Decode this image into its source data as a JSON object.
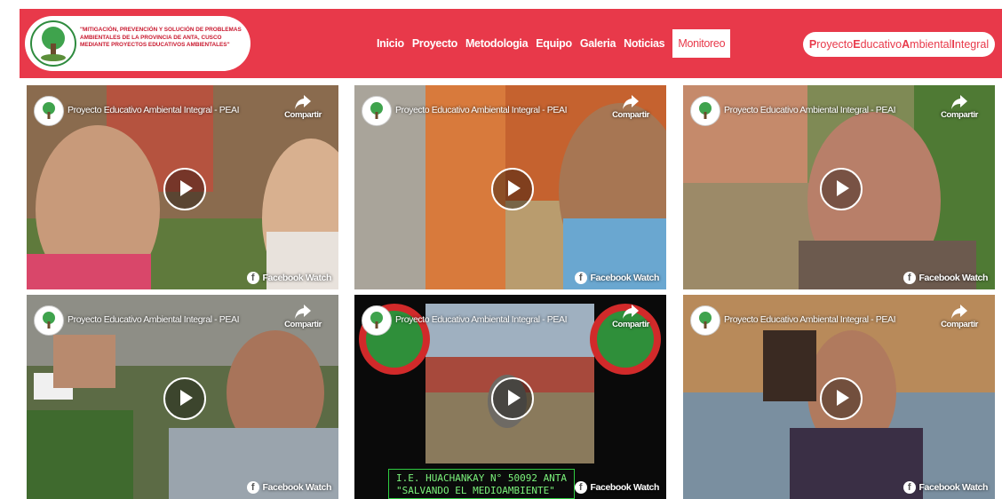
{
  "header": {
    "logo_text": "\"Mitigación, prevención y solución de problemas ambientales de la provincia de Anta, Cusco mediante proyectos educativos ambientales\"",
    "nav": [
      "Inicio",
      "Proyecto",
      "Metodologia",
      "Equipo",
      "Galeria",
      "Noticias",
      "Monitoreo"
    ],
    "active_nav": "Monitoreo",
    "brand": [
      "P",
      "royecto ",
      "E",
      "ducativo ",
      "A",
      "mbiental ",
      "I",
      "ntegral"
    ]
  },
  "videos": [
    {
      "channel": "Proyecto Educativo Ambiental Integral - PEAI",
      "share": "Compartir",
      "watch": "Facebook Watch"
    },
    {
      "channel": "Proyecto Educativo Ambiental Integral - PEAI",
      "share": "Compartir",
      "watch": "Facebook Watch"
    },
    {
      "channel": "Proyecto Educativo Ambiental Integral - PEAI",
      "share": "Compartir",
      "watch": "Facebook Watch"
    },
    {
      "channel": "Proyecto Educativo Ambiental Integral - PEAI",
      "share": "Compartir",
      "watch": "Facebook Watch"
    },
    {
      "channel": "Proyecto Educativo Ambiental Integral - PEAI",
      "share": "Compartir",
      "watch": "Facebook Watch",
      "caption": "I.E. HUACHANKAY N° 50092 ANTA\n\"SALVANDO EL MEDIOAMBIENTE\""
    },
    {
      "channel": "Proyecto Educativo Ambiental Integral - PEAI",
      "share": "Compartir",
      "watch": "Facebook Watch"
    }
  ],
  "colors": {
    "accent": "#e8394a",
    "white": "#ffffff"
  },
  "icons": {
    "share": "share-arrow-icon",
    "play": "play-icon",
    "facebook": "facebook-icon",
    "logo": "tree-logo-icon"
  }
}
